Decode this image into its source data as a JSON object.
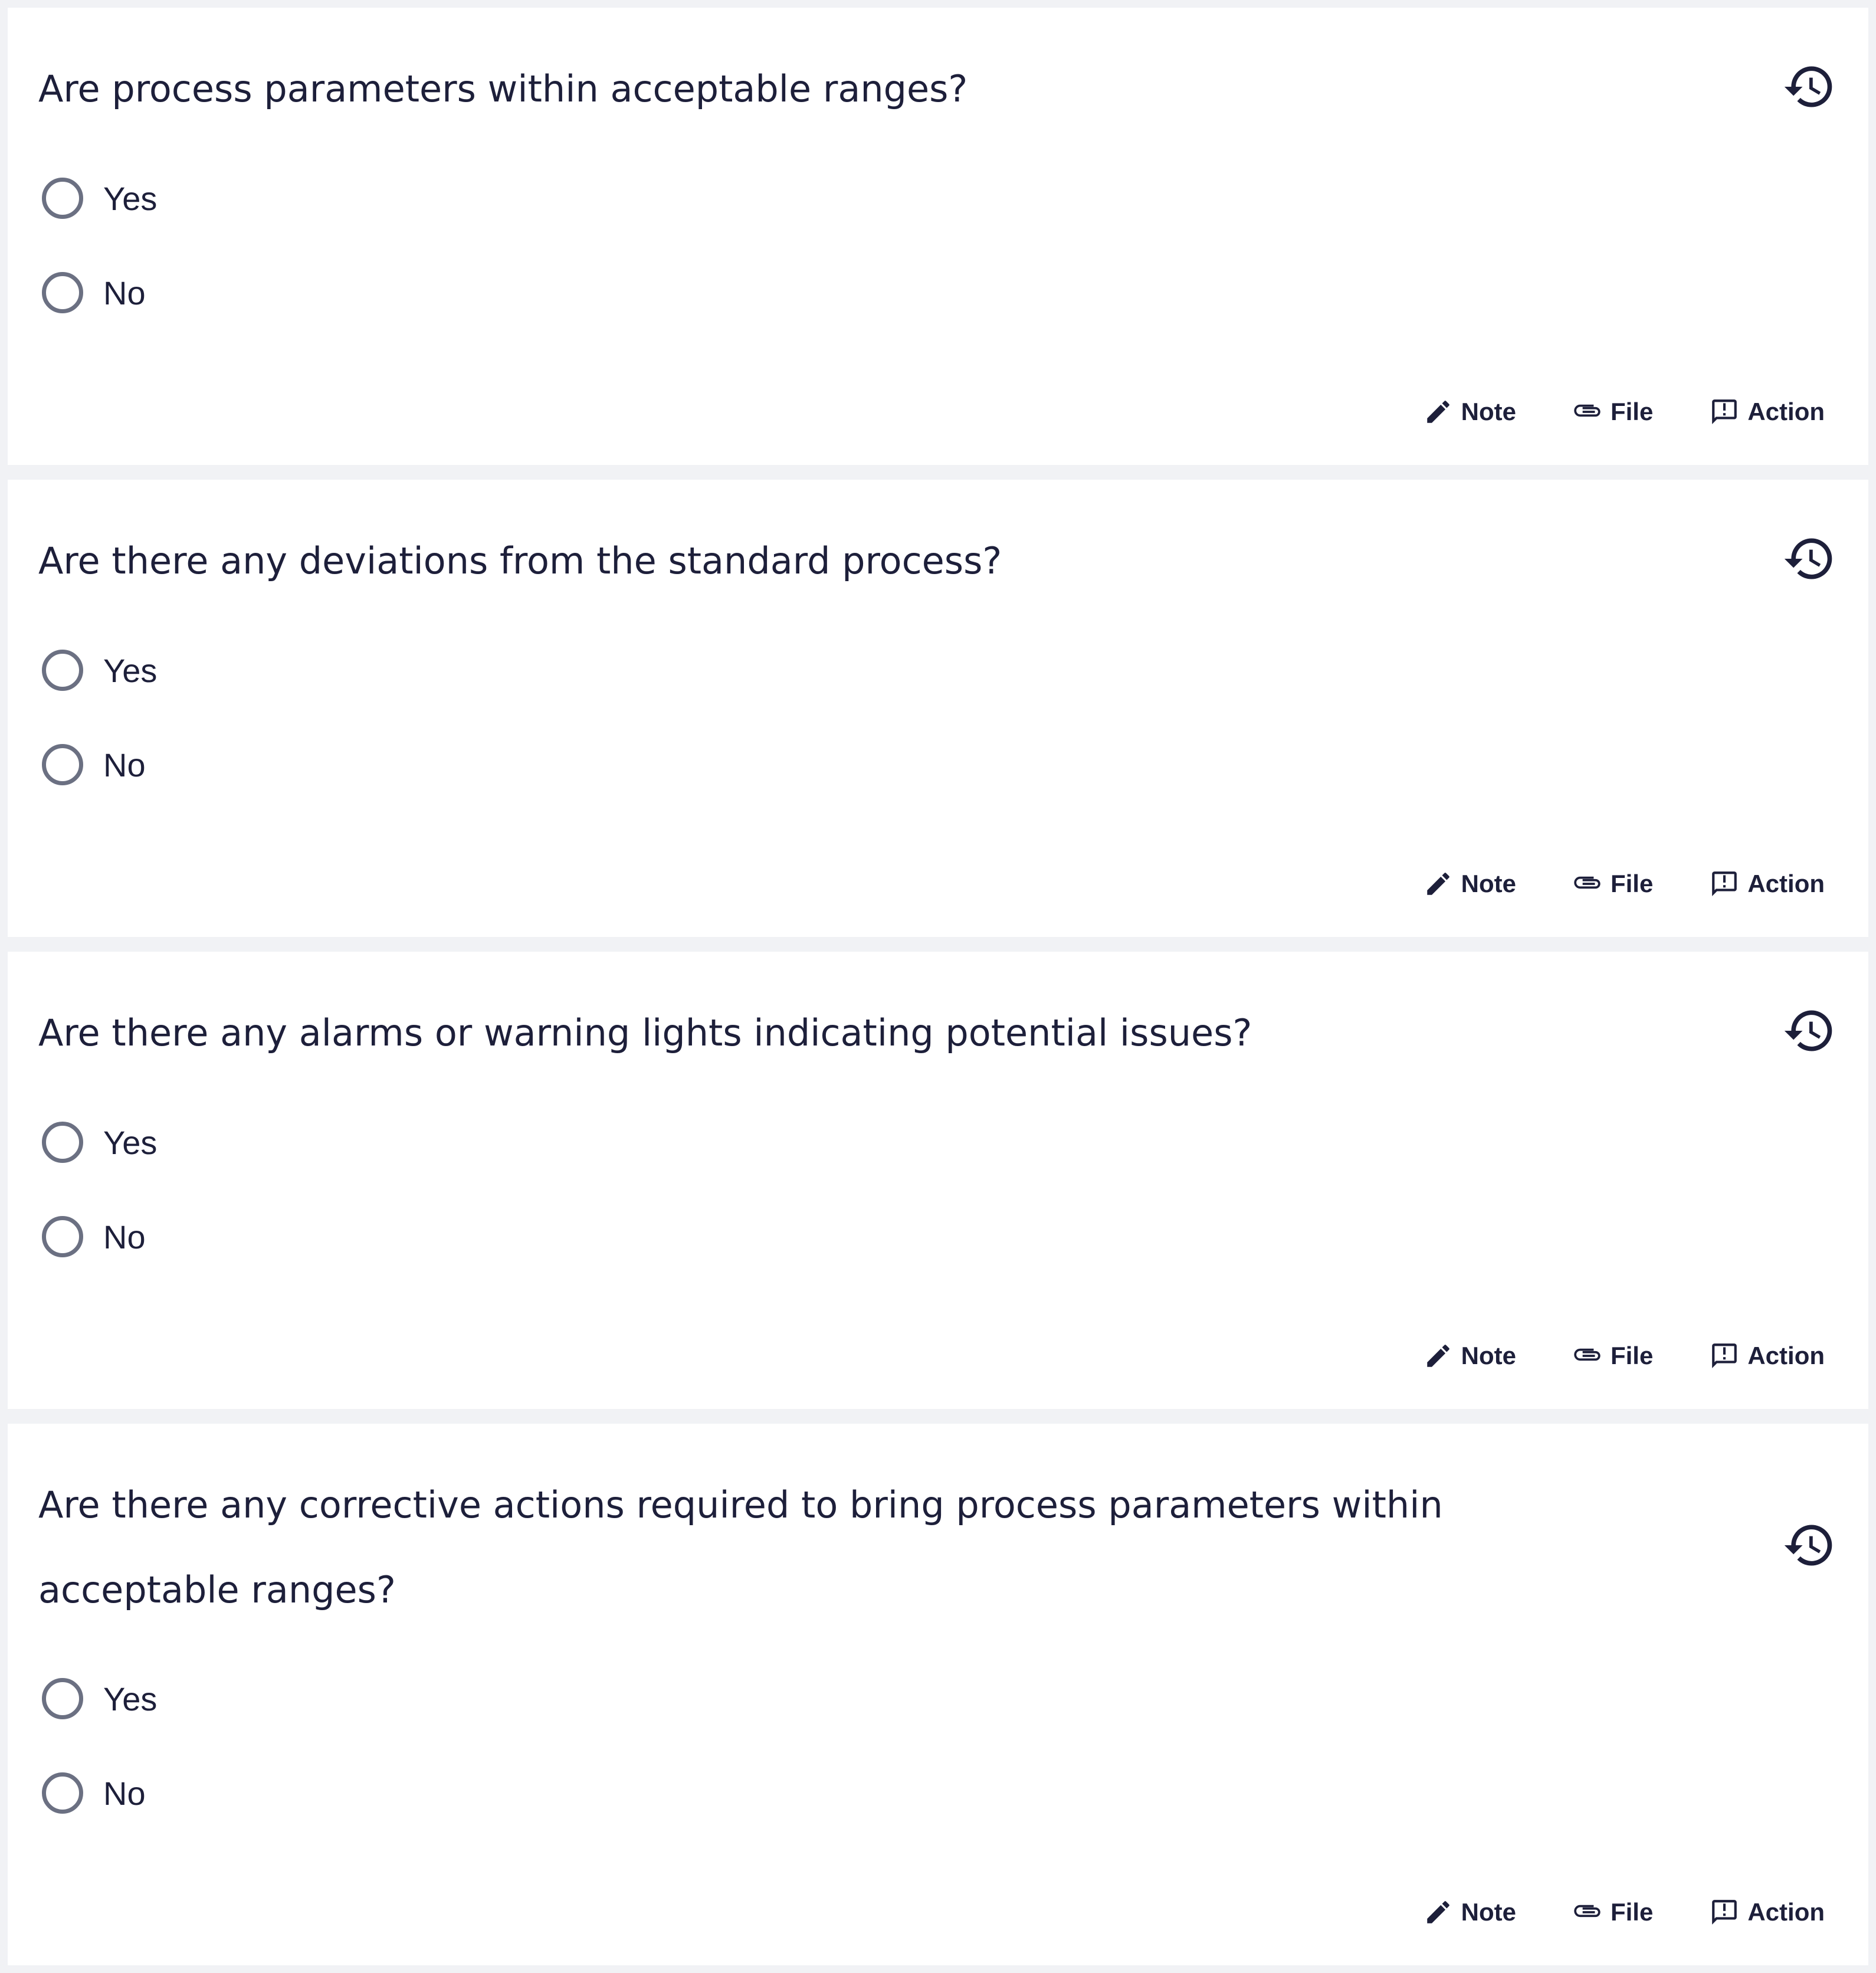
{
  "questions": [
    {
      "text": "Are process parameters within acceptable ranges?",
      "options": [
        "Yes",
        "No"
      ],
      "actions": [
        "Note",
        "File",
        "Action"
      ]
    },
    {
      "text": "Are there any deviations from the standard process?",
      "options": [
        "Yes",
        "No"
      ],
      "actions": [
        "Note",
        "File",
        "Action"
      ]
    },
    {
      "text": "Are there any alarms or warning lights indicating potential issues?",
      "options": [
        "Yes",
        "No"
      ],
      "actions": [
        "Note",
        "File",
        "Action"
      ]
    },
    {
      "text": "Are there any corrective actions required to bring process parameters within acceptable ranges?",
      "options": [
        "Yes",
        "No"
      ],
      "actions": [
        "Note",
        "File",
        "Action"
      ]
    }
  ],
  "icons": {
    "history": "history-icon",
    "note": "pencil-icon",
    "file": "paperclip-icon",
    "action": "feedback-icon"
  },
  "colors": {
    "text": "#1d1f3a",
    "radio_border": "#6b7082",
    "background": "#f1f2f5",
    "card": "#ffffff"
  }
}
